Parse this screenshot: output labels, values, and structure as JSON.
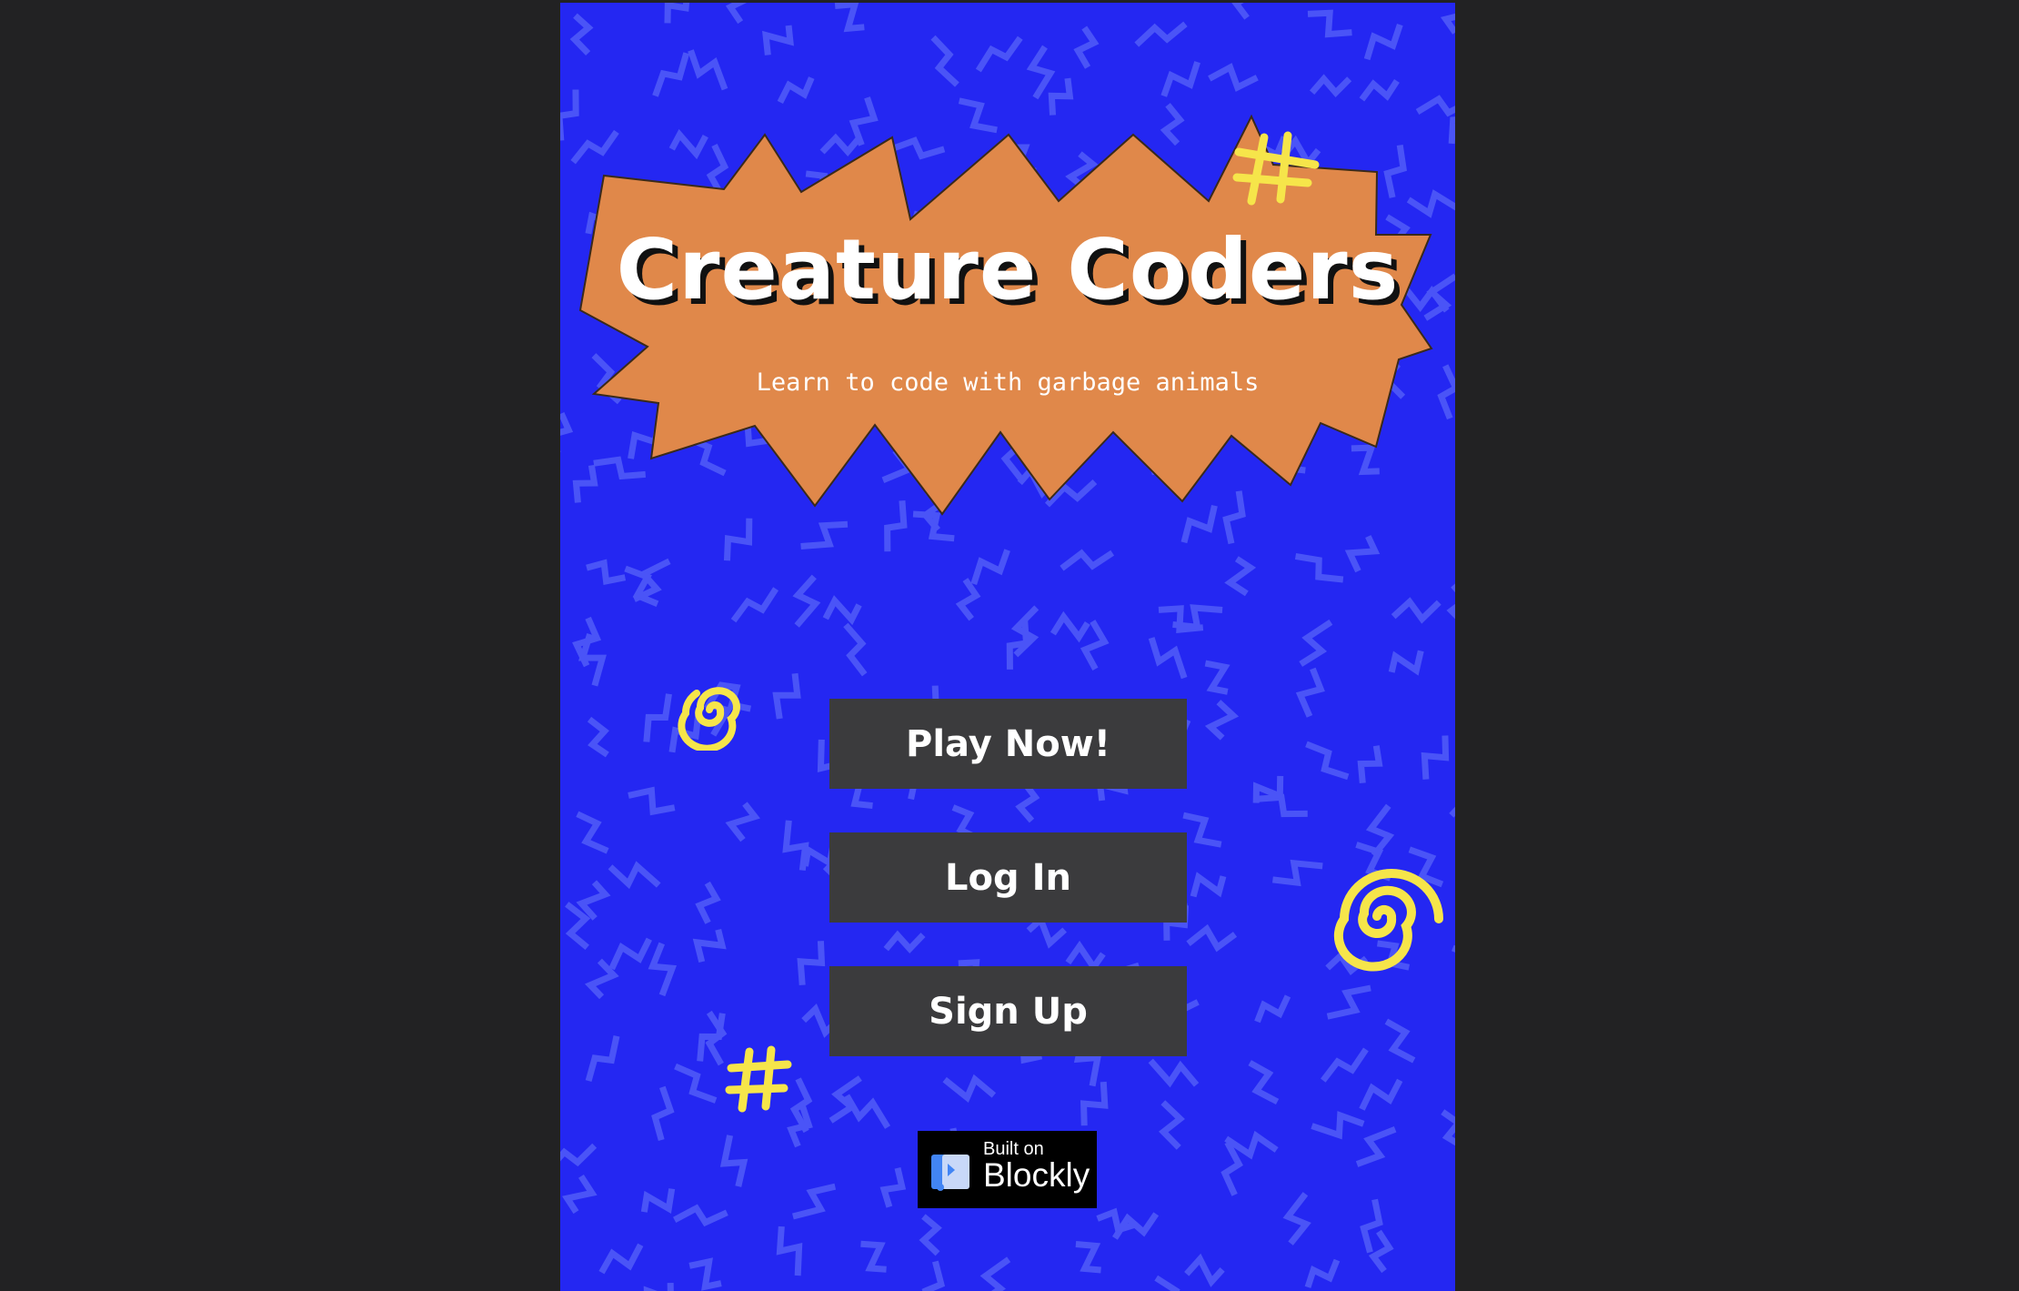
{
  "app": {
    "title": "Creature Coders",
    "tagline": "Learn to code with garbage animals"
  },
  "menu": {
    "buttons": [
      {
        "label": "Play Now!"
      },
      {
        "label": "Log In"
      },
      {
        "label": "Sign Up"
      }
    ]
  },
  "badge": {
    "line1": "Built on",
    "line2": "Blockly"
  },
  "colors": {
    "page_background": "#222223",
    "app_background": "#2427f2",
    "pattern": "#4a54f7",
    "burst_fill": "#e0884a",
    "burst_outline": "#3a2a1a",
    "decoration_yellow": "#f6e54a",
    "button_background": "#3b3b3d",
    "button_text": "#ffffff",
    "badge_background": "#000000"
  },
  "icons": {
    "decorations": [
      "hash-icon",
      "spiral-icon",
      "spiral-icon",
      "hash-icon"
    ],
    "badge_logo": "blockly-logo-icon"
  }
}
